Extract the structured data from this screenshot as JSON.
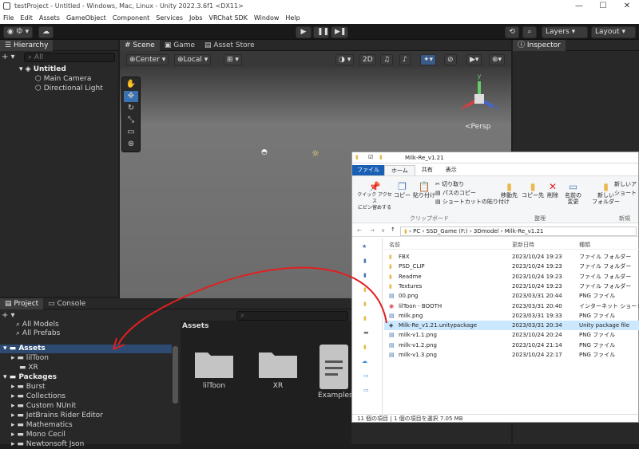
{
  "titlebar": {
    "title": "testProject - Untitled - Windows, Mac, Linux - Unity 2022.3.6f1 <DX11>",
    "minimize": "—",
    "maximize": "☐",
    "close": "✕"
  },
  "menu": [
    "File",
    "Edit",
    "Assets",
    "GameObject",
    "Component",
    "Services",
    "Jobs",
    "VRChat SDK",
    "Window",
    "Help"
  ],
  "toolbar": {
    "account": "◉ ゆ ▾",
    "cloud": "☁",
    "layers": "Layers",
    "layout": "Layout",
    "play": "▶",
    "pause": "❚❚",
    "step": "▶❚"
  },
  "hierarchy": {
    "tab": "Hierarchy",
    "add": "+ ▾",
    "search_placeholder": "All",
    "scene": "Untitled",
    "items": [
      "Main Camera",
      "Directional Light"
    ]
  },
  "scene": {
    "tabs": [
      "Scene",
      "Game",
      "Asset Store"
    ],
    "pivot": "Center",
    "space": "Local",
    "mode2d": "2D",
    "persp": "<Persp",
    "gizmo": {
      "x": "x",
      "y": "y",
      "z": "z"
    }
  },
  "inspector": {
    "tab": "Inspector"
  },
  "project": {
    "tabs": [
      "Project",
      "Console"
    ],
    "add": "+ ▾",
    "favorites": [
      "All Models",
      "All Prefabs"
    ],
    "assets_root": "Assets",
    "asset_children": [
      "lilToon",
      "XR"
    ],
    "packages_root": "Packages",
    "packages": [
      "Burst",
      "Collections",
      "Custom NUnit",
      "JetBrains Rider Editor",
      "Mathematics",
      "Mono Cecil",
      "Newtonsoft Json"
    ],
    "breadcrumb": "Assets",
    "grid": [
      "lilToon",
      "XR",
      "Examples a"
    ]
  },
  "explorer": {
    "title": "Milk-Re_v1.21",
    "ribbon_tabs": [
      "ファイル",
      "ホーム",
      "共有",
      "表示"
    ],
    "clipboard": {
      "pin": "クイック アクセス\nにピン留めする",
      "copy": "コピー",
      "paste": "貼り付け",
      "cut": "切り取り",
      "copy_path": "パスのコピー",
      "paste_shortcut": "ショートカットの貼り付け",
      "group": "クリップボード"
    },
    "organize": {
      "move": "移動先",
      "copyto": "コピー先",
      "delete": "削除",
      "rename": "名前の\n変更",
      "group": "整理"
    },
    "new": {
      "folder": "新しい\nフォルダー",
      "item": "新しいア",
      "shortcut": "ショート",
      "group": "新規"
    },
    "address": [
      "PC",
      "SSD_Game (F:)",
      "3Dmodel",
      "Milk-Re_v1.21"
    ],
    "columns": [
      "名前",
      "更新日時",
      "種類"
    ],
    "files": [
      {
        "name": "FBX",
        "date": "2023/10/24 19:23",
        "type": "ファイル フォルダー",
        "kind": "folder"
      },
      {
        "name": "PSD_CLIP",
        "date": "2023/10/24 19:23",
        "type": "ファイル フォルダー",
        "kind": "folder"
      },
      {
        "name": "Readme",
        "date": "2023/10/24 19:23",
        "type": "ファイル フォルダー",
        "kind": "folder"
      },
      {
        "name": "Textures",
        "date": "2023/10/24 19:23",
        "type": "ファイル フォルダー",
        "kind": "folder"
      },
      {
        "name": "00.png",
        "date": "2023/03/31 20:44",
        "type": "PNG ファイル",
        "kind": "png"
      },
      {
        "name": "lilToon - BOOTH",
        "date": "2023/03/31 20:40",
        "type": "インターネット ショート...",
        "kind": "link"
      },
      {
        "name": "milk.png",
        "date": "2023/03/31 19:33",
        "type": "PNG ファイル",
        "kind": "png"
      },
      {
        "name": "Milk-Re_v1.21.unitypackage",
        "date": "2023/03/31 20:34",
        "type": "Unity package file",
        "kind": "unity"
      },
      {
        "name": "milk-v1.1.png",
        "date": "2023/10/24 20:24",
        "type": "PNG ファイル",
        "kind": "png"
      },
      {
        "name": "milk-v1.2.png",
        "date": "2023/10/24 21:14",
        "type": "PNG ファイル",
        "kind": "png"
      },
      {
        "name": "milk-v1.3.png",
        "date": "2023/10/24 22:17",
        "type": "PNG ファイル",
        "kind": "png"
      }
    ],
    "status": "11 個の項目  |  1 個の項目を選択  7.05 MB"
  },
  "colors": {
    "accent": "#3a72b0",
    "annotation": "#e02020",
    "selection": "#cce8ff"
  }
}
